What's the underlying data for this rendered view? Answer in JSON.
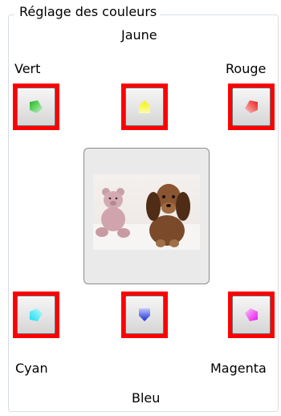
{
  "group": {
    "title": "Réglage des couleurs"
  },
  "labels": {
    "yellow": "Jaune",
    "green": "Vert",
    "red": "Rouge",
    "cyan": "Cyan",
    "blue": "Bleu",
    "magenta": "Magenta"
  },
  "buttons": {
    "green": {
      "icon": "green-arrow-icon",
      "color": "#22c022"
    },
    "yellow": {
      "icon": "yellow-arrow-icon",
      "color": "#f2f200"
    },
    "red": {
      "icon": "red-arrow-icon",
      "color": "#f02020"
    },
    "cyan": {
      "icon": "cyan-arrow-icon",
      "color": "#20e8f0"
    },
    "blue": {
      "icon": "blue-arrow-icon",
      "color": "#2030e0"
    },
    "magenta": {
      "icon": "magenta-arrow-icon",
      "color": "#ee20ee"
    }
  },
  "highlight_color": "#ff0000",
  "preview": {
    "icon": "preview-photo-dog-and-teddy-bear"
  }
}
